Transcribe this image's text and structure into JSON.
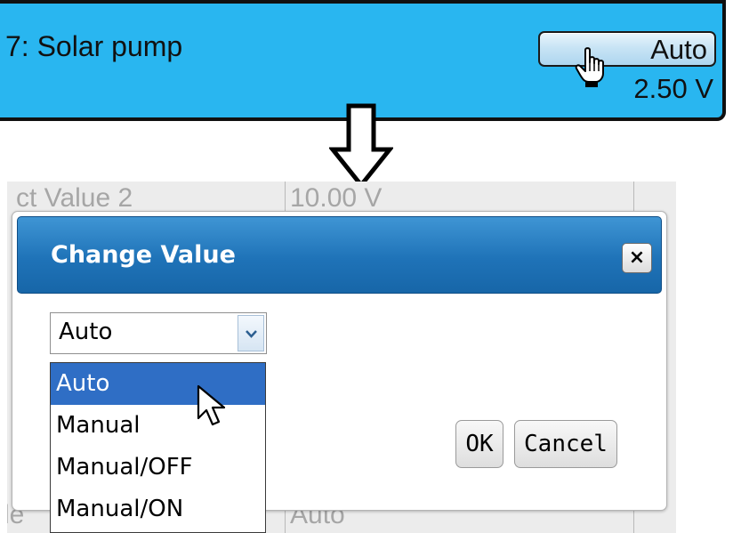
{
  "output": {
    "title": "7: Solar pump",
    "mode_button_label": "Auto",
    "value": "2.50 V"
  },
  "background_page": {
    "top_left_text": "ct Value 2",
    "top_mid_text": "10.00 V",
    "bottom_left_text": "le",
    "bottom_mid_text": "Auto"
  },
  "dialog": {
    "title": "Change Value",
    "close_icon": "×",
    "select": {
      "value": "Auto",
      "options": [
        "Auto",
        "Manual",
        "Manual/OFF",
        "Manual/ON"
      ],
      "highlighted_index": 0
    },
    "ok_label": "OK",
    "cancel_label": "Cancel"
  },
  "icons": {
    "hand_cursor": "hand-pointer-icon",
    "arrow_cursor": "mouse-pointer-icon",
    "down_arrow": "arrow-down-icon",
    "select_chevron": "chevron-down-icon"
  },
  "colors": {
    "panel_background": "#29b6f0",
    "dialog_header": "#1f73b8",
    "highlight": "#2f6ec5"
  }
}
